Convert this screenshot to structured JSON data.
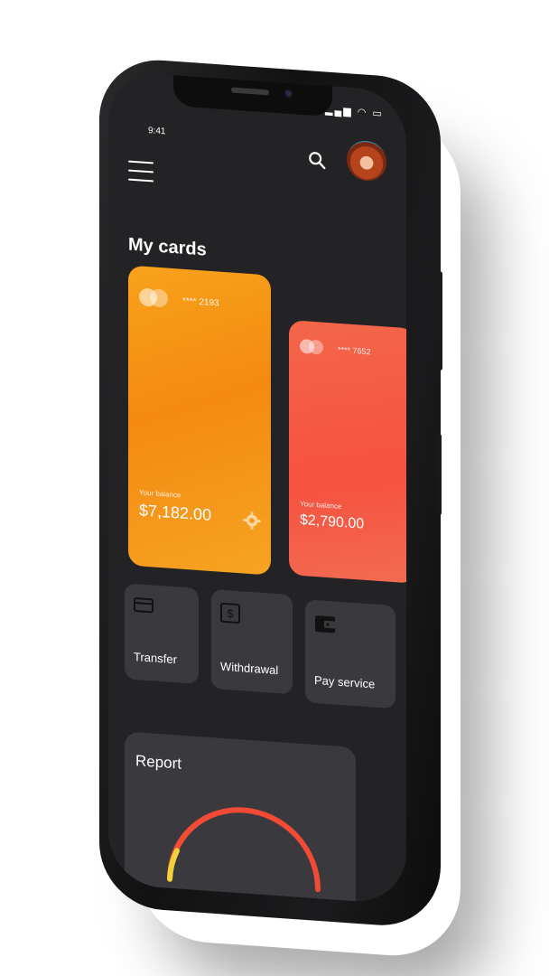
{
  "status_bar": {
    "time": "9:41",
    "icons": "▂▄▆ ◠ ▭"
  },
  "header": {
    "menu_icon": "hamburger-icon",
    "search_icon": "search-icon",
    "avatar": "user-avatar"
  },
  "cards_section": {
    "title": "My cards"
  },
  "cards": [
    {
      "number": "**** 2193",
      "balance_label": "Your balance",
      "balance": "$7,182.00",
      "color": "#f59416"
    },
    {
      "number": "**** 7652",
      "balance_label": "Your balance",
      "balance": "$2,790.00",
      "color": "#f5553f"
    }
  ],
  "actions": [
    {
      "label": "Transfer",
      "icon": "card-icon"
    },
    {
      "label": "Withdrawal",
      "icon": "dollar-icon"
    },
    {
      "label": "Pay service",
      "icon": "wallet-icon"
    }
  ],
  "report": {
    "title": "Report",
    "accent_colors": [
      "#f24a35",
      "#f2d23a"
    ]
  }
}
